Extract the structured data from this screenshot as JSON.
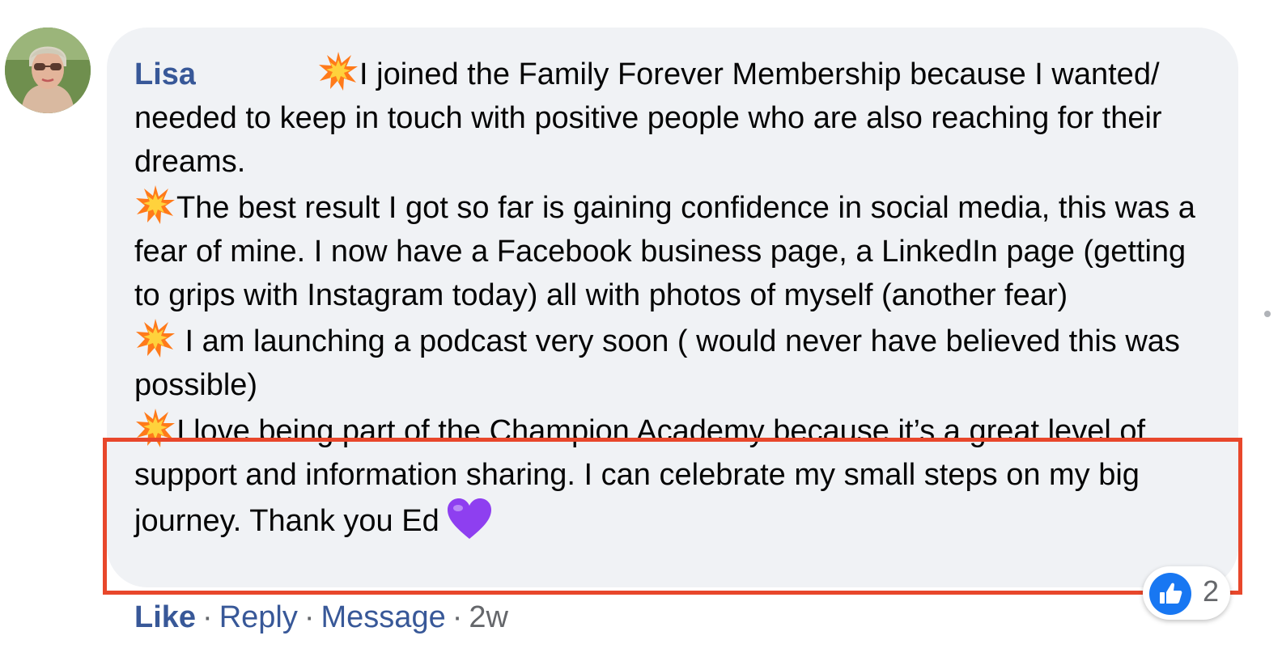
{
  "comment": {
    "author_name": "Lisa",
    "paragraphs": [
      "I joined the Family Forever Membership because I wanted/ needed to keep in touch with positive people who are also reaching for their dreams.",
      "The best result I got so far is gaining confidence in social media, this was a fear of mine. I now have a Facebook business page, a LinkedIn page (getting to grips with Instagram today) all with photos of myself (another fear)",
      " I am launching a podcast very soon ( would never have believed this was possible)",
      "I love being part of the Champion Academy because it’s a great level of support and information sharing. I can celebrate my small steps on my big journey. Thank you Ed"
    ],
    "emoji_icons": [
      "collision-burst-icon",
      "purple-heart-icon"
    ],
    "highlight_color": "#e8472b"
  },
  "actions": {
    "like_label": "Like",
    "sep": "·",
    "reply_label": "Reply",
    "message_label": "Message",
    "time_label": "2w"
  },
  "reaction": {
    "icon": "thumbs-up-icon",
    "count": "2"
  },
  "colors": {
    "link": "#385898",
    "bubble_bg": "#f0f2f5",
    "like_blue": "#1877f2"
  }
}
